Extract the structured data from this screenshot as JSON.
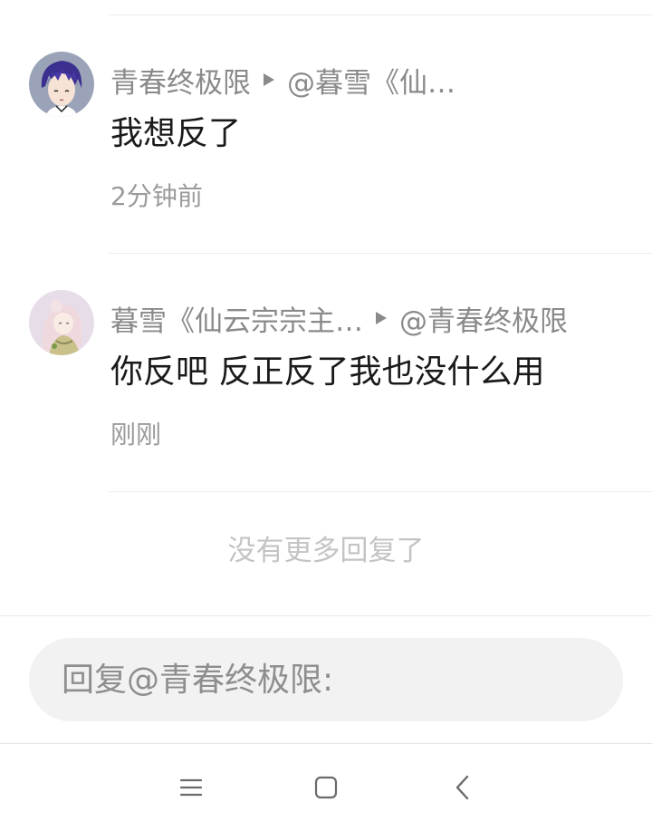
{
  "comments": [
    {
      "author": "青春终极限",
      "reply_to": "@暮雪《仙…",
      "text": "我想反了",
      "time": "2分钟前",
      "avatar": "avatar-purple-hair-boy"
    },
    {
      "author": "暮雪《仙云宗宗主…",
      "reply_to": "@青春终极限",
      "text": "你反吧 反正反了我也没什么用",
      "time": "刚刚",
      "avatar": "avatar-pink-hair-girl"
    }
  ],
  "footer": {
    "no_more": "没有更多回复了"
  },
  "reply": {
    "placeholder": "回复@青春终极限:"
  },
  "navbar": {
    "menu_icon": "menu-icon",
    "home_icon": "home-icon",
    "back_icon": "back-icon"
  }
}
